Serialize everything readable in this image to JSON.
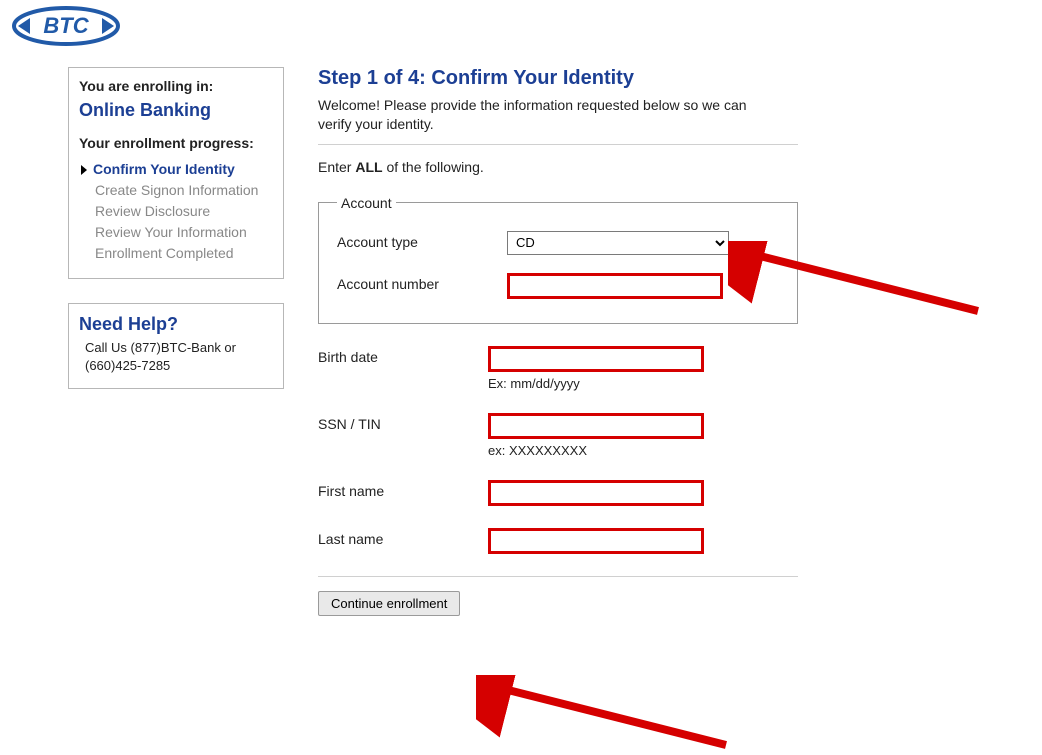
{
  "logo_text": "BTC",
  "sidebar": {
    "enrolling_label": "You are enrolling in:",
    "product_title": "Online Banking",
    "progress_label": "Your enrollment progress:",
    "steps": [
      "Confirm Your Identity",
      "Create Signon Information",
      "Review Disclosure",
      "Review Your Information",
      "Enrollment Completed"
    ],
    "help_title": "Need Help?",
    "help_body": "Call Us  (877)BTC-Bank or (660)425-7285"
  },
  "main": {
    "title": "Step 1 of 4: Confirm Your Identity",
    "intro": "Welcome! Please provide the information requested below so we can verify your identity.",
    "enter_prefix": "Enter ",
    "enter_strong": "ALL",
    "enter_suffix": " of the following.",
    "fieldset_legend": "Account",
    "labels": {
      "account_type": "Account type",
      "account_number": "Account number",
      "birth_date": "Birth date",
      "ssn": "SSN / TIN",
      "first_name": "First name",
      "last_name": "Last name"
    },
    "hints": {
      "birth_date": "Ex: mm/dd/yyyy",
      "ssn": "ex: XXXXXXXXX"
    },
    "account_type_selected": "CD",
    "account_type_options": [
      "CD"
    ],
    "values": {
      "account_number": "",
      "birth_date": "",
      "ssn": "",
      "first_name": "",
      "last_name": ""
    },
    "continue_label": "Continue enrollment"
  },
  "colors": {
    "brand_blue": "#1c3f94",
    "annotation_red": "#d50000"
  }
}
